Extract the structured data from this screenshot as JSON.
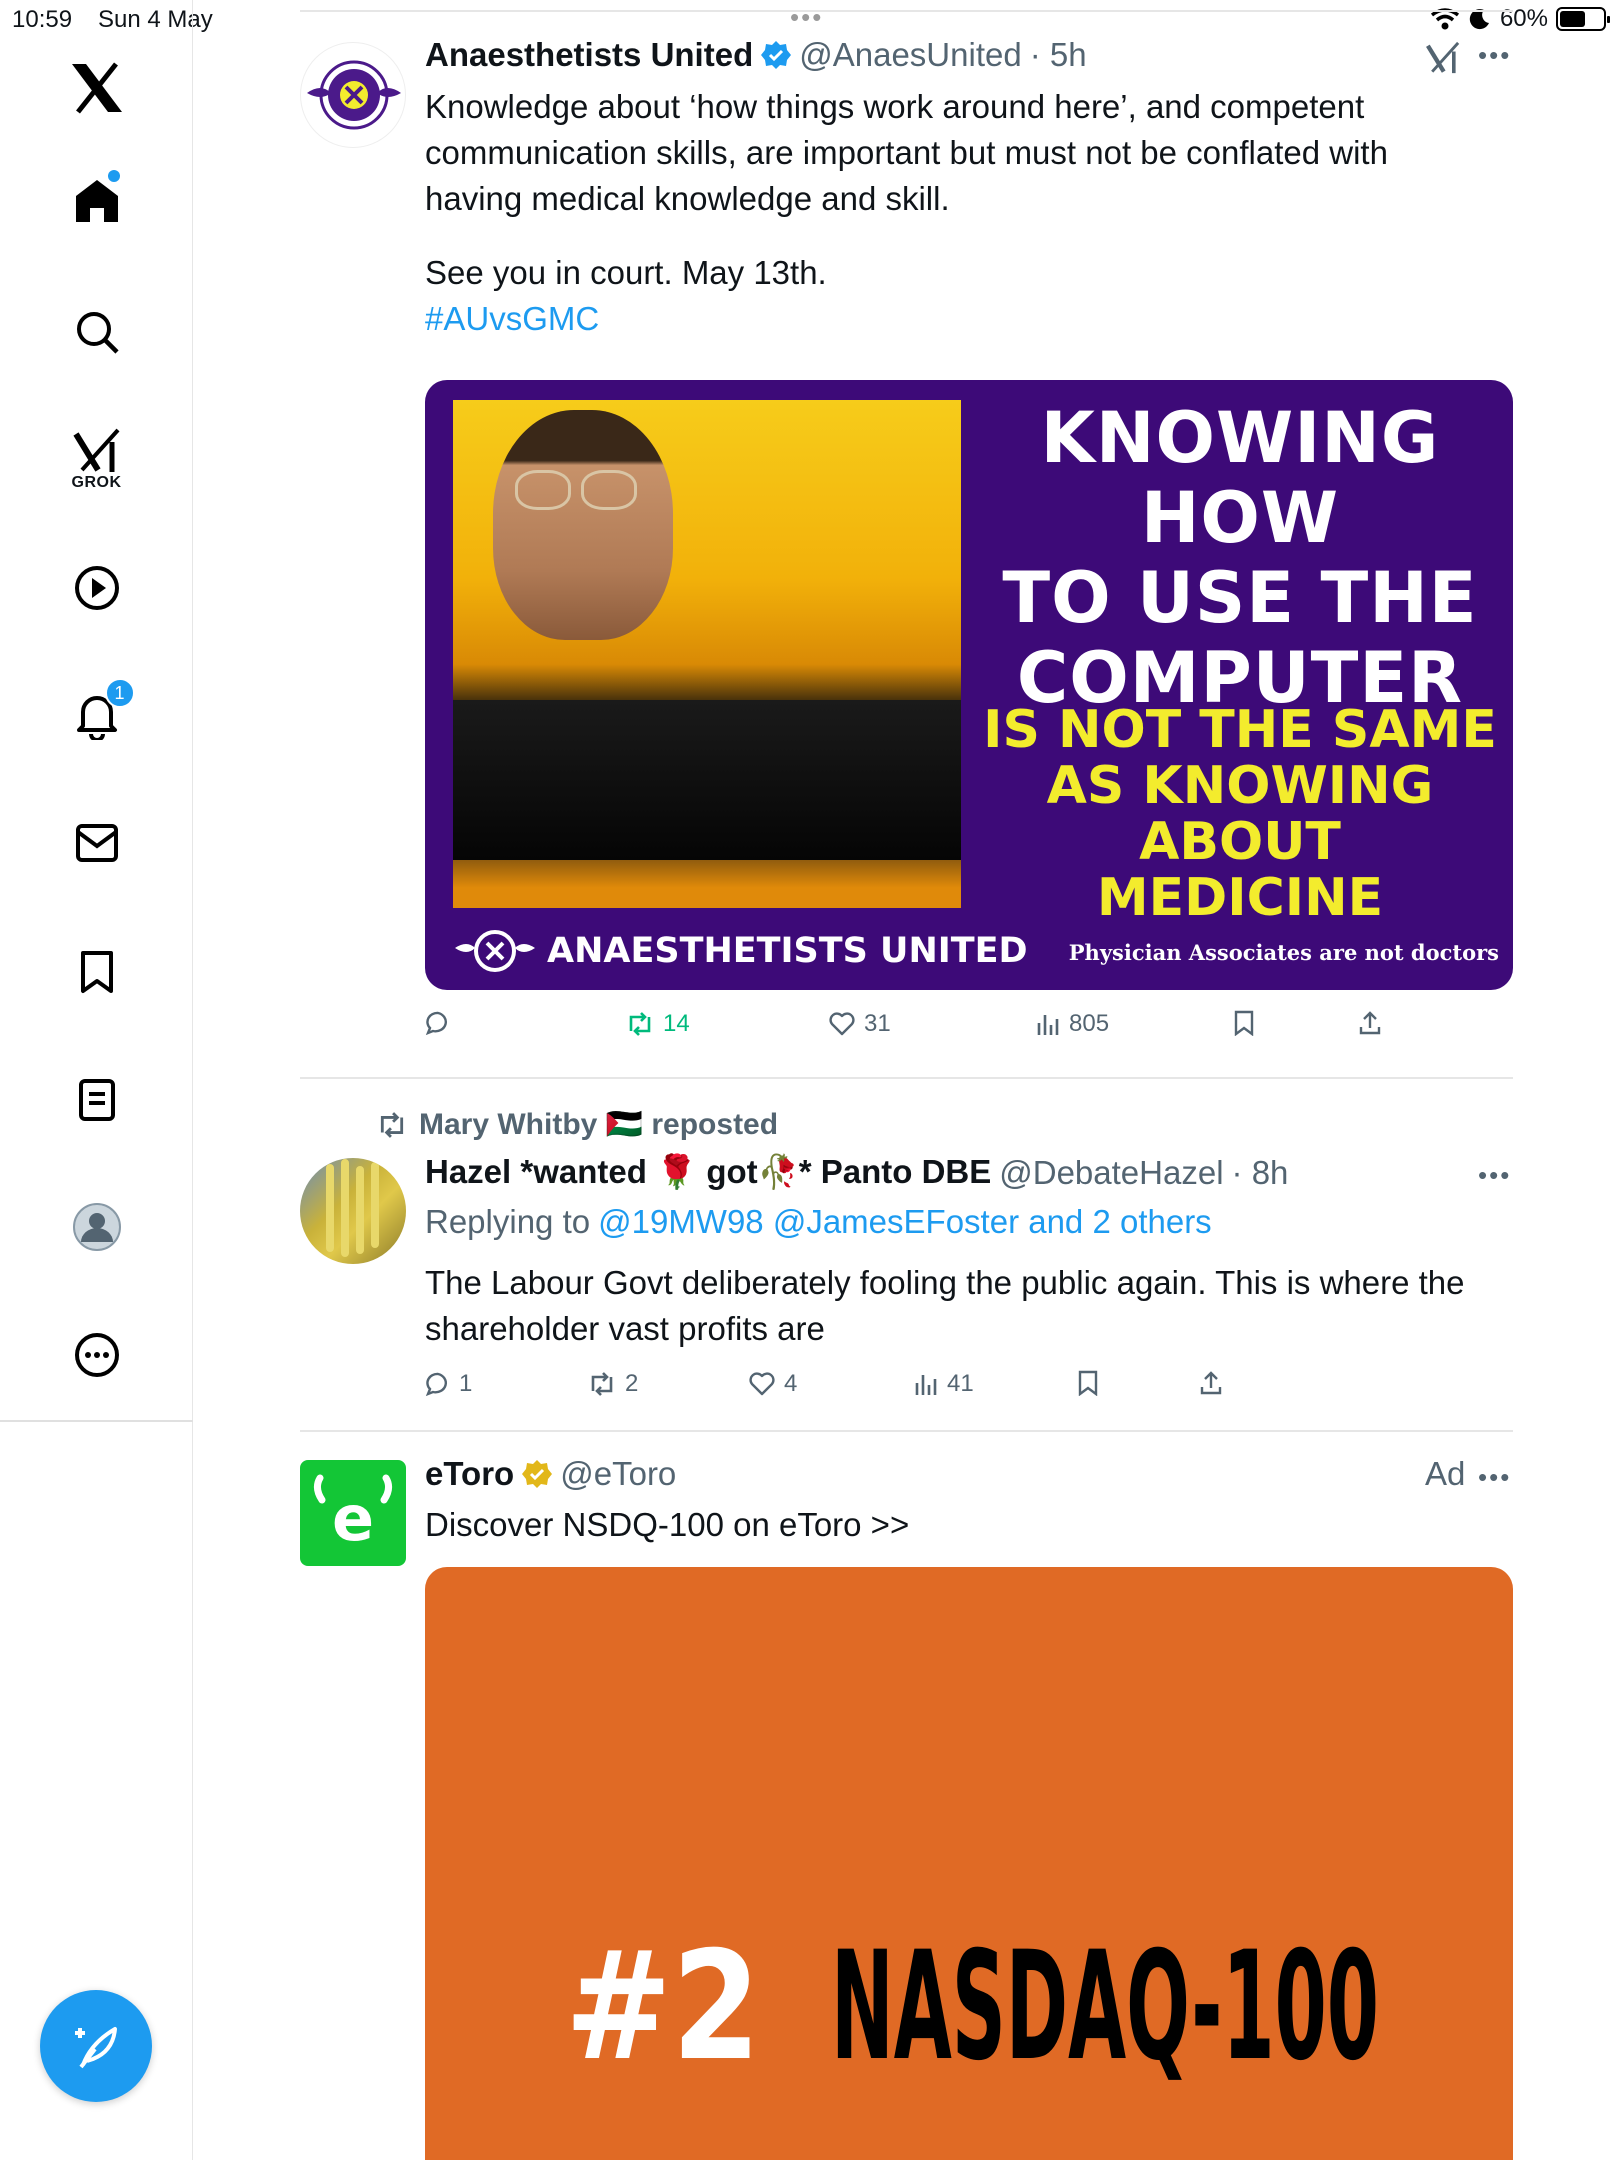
{
  "status_bar": {
    "time": "10:59",
    "date": "Sun 4 May",
    "battery": "60%",
    "battery_level": 0.6
  },
  "sidebar": {
    "items": [
      {
        "icon": "x-logo-icon"
      },
      {
        "icon": "home-icon",
        "has_dot": true
      },
      {
        "icon": "search-icon"
      },
      {
        "icon": "grok-icon",
        "label": "GROK"
      },
      {
        "icon": "video-play-icon"
      },
      {
        "icon": "bell-icon",
        "badge": "1"
      },
      {
        "icon": "mail-icon"
      },
      {
        "icon": "bookmark-icon"
      },
      {
        "icon": "lists-icon"
      },
      {
        "icon": "profile-avatar-icon"
      },
      {
        "icon": "more-circle-icon"
      }
    ],
    "compose_icon": "compose-quill-icon"
  },
  "tweets": [
    {
      "name": "Anaesthetists United",
      "handle": "@AnaesUnited",
      "time": "· 5h",
      "text_lines": [
        "Knowledge about ‘how things work around here’, and competent",
        "communication skills, are important but must not be conflated with",
        "having medical knowledge and skill."
      ],
      "text_after": "See you in court. May 13th.",
      "hashtag": "#AUvsGMC",
      "media": {
        "headline": [
          "KNOWING HOW",
          "TO USE THE",
          "COMPUTER"
        ],
        "sub": [
          "IS NOT THE SAME",
          "AS KNOWING ABOUT",
          "MEDICINE"
        ],
        "brand": "ANAESTHETISTS UNITED",
        "tagline": "Physician Associates are not doctors"
      },
      "actions": {
        "replies": "",
        "reposts": "14",
        "likes": "31",
        "views": "805"
      }
    },
    {
      "repost_by": "Mary Whitby 🇵🇸 reposted",
      "name": "Hazel *wanted 🌹 got🥀* Panto DBE",
      "handle": "@DebateHazel",
      "time": "· 8h",
      "replying_prefix": "Replying to",
      "replying_to": "@19MW98 @JamesEFoster and 2 others",
      "text_lines": [
        "The Labour Govt deliberately fooling the public again.  This is where the",
        "shareholder vast profits are"
      ],
      "actions": {
        "replies": "1",
        "reposts": "2",
        "likes": "4",
        "views": "41"
      }
    },
    {
      "name": "eToro",
      "handle": "@eToro",
      "ad_label": "Ad",
      "text": "Discover NSDQ-100 on eToro >>",
      "media": {
        "rank": "#2",
        "index": "NASDAQ-100"
      }
    }
  ],
  "colors": {
    "accent": "#1d9bf0",
    "repost_green": "#00ba7c",
    "media_purple": "#3d0a78",
    "media_yellow": "#f3ec2d",
    "etoro_green": "#13c636",
    "ad_orange": "#e06a25"
  }
}
